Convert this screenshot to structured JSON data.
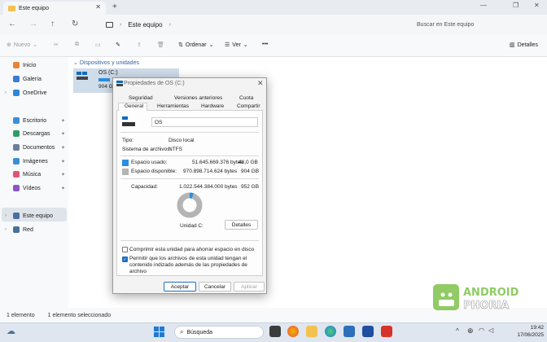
{
  "window": {
    "tab_title": "Este equipo",
    "breadcrumb": "Este equipo",
    "search_placeholder": "Buscar en Este equipo"
  },
  "toolbar": {
    "new": "Nuevo",
    "sort": "Ordenar",
    "view": "Ver",
    "more": "•••",
    "details": "Detalles"
  },
  "sidebar": {
    "items": [
      {
        "label": "Inicio",
        "color": "#e8833a"
      },
      {
        "label": "Galería",
        "color": "#3a7bd5"
      },
      {
        "label": "OneDrive",
        "color": "#2b88d8"
      },
      {
        "label": "Escritorio",
        "color": "#3a8fd8"
      },
      {
        "label": "Descargas",
        "color": "#2f9e65"
      },
      {
        "label": "Documentos",
        "color": "#6b7f99"
      },
      {
        "label": "Imágenes",
        "color": "#3b8ed5"
      },
      {
        "label": "Música",
        "color": "#e0547a"
      },
      {
        "label": "Vídeos",
        "color": "#8d55c9"
      },
      {
        "label": "Este equipo",
        "color": "#4a6f9c"
      },
      {
        "label": "Red",
        "color": "#4a6f9c"
      }
    ]
  },
  "main": {
    "group_label": "Dispositivos y unidades",
    "drive_name": "OS (C:)",
    "drive_free": "904 GB"
  },
  "status": {
    "count": "1 elemento",
    "selected": "1 elemento seleccionado"
  },
  "dialog": {
    "title": "Propiedades de OS (C:)",
    "tabs_row1": [
      "Seguridad",
      "Versiones anteriores",
      "Cuota"
    ],
    "tabs_row2": [
      "General",
      "Herramientas",
      "Hardware",
      "Compartir"
    ],
    "name": "OS",
    "type_label": "Tipo:",
    "type_value": "Disco local",
    "fs_label": "Sistema de archivos:",
    "fs_value": "NTFS",
    "used_label": "Espacio usado:",
    "used_bytes": "51.645.669.376 bytes",
    "used_gb": "48,0 GB",
    "free_label": "Espacio disponible:",
    "free_bytes": "970.898.714.624 bytes",
    "free_gb": "904 GB",
    "cap_label": "Capacidad:",
    "cap_bytes": "1.022.544.384.000 bytes",
    "cap_gb": "952 GB",
    "unit_label": "Unidad C:",
    "details_button": "Detalles",
    "compress_label": "Comprimir esta unidad para ahorrar espacio en disco",
    "index_label": "Permitir que los archivos de esta unidad tengan el contenido indizado además de las propiedades de archivo",
    "accept": "Aceptar",
    "cancel": "Cancelar",
    "apply": "Aplicar",
    "used_fraction": 0.05,
    "used_color": "#2a8ee0",
    "free_color": "#b4b4b4"
  },
  "taskbar": {
    "search": "Búsqueda",
    "time": "19:42",
    "date": "17/06/2025"
  }
}
